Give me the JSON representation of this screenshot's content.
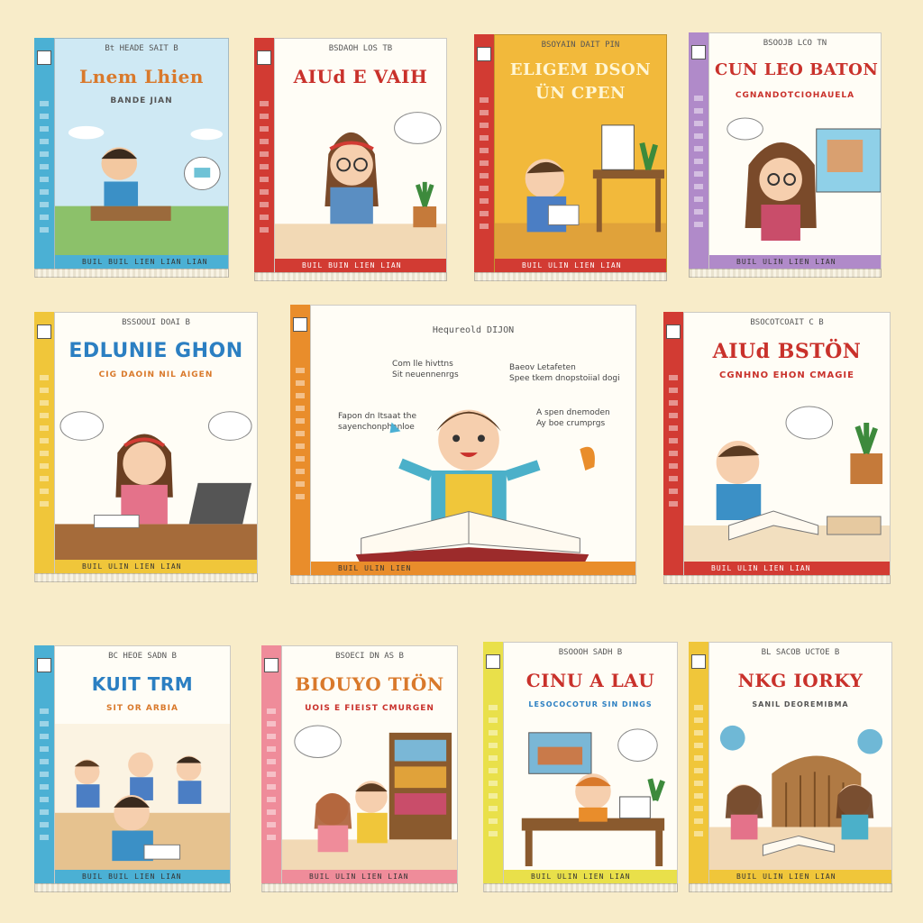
{
  "colors": {
    "background": "#f8ecc9",
    "blue": "#4bb0d4",
    "red": "#d23b33",
    "orange": "#e98d2b",
    "purple": "#b08ac9",
    "yellow": "#f0c63a",
    "pink": "#ef8c9a",
    "lightyellow": "#e9e04a"
  },
  "books": [
    {
      "series": "Bt HEADE SAIT B",
      "title": "Lnem Lhien",
      "subtitle": "BANDE JIAN",
      "band": "BUIL BUIL LIEN LIAN LIAN"
    },
    {
      "series": "BSDAOH LOS TB",
      "title": "AIUd E VAIH",
      "subtitle": "",
      "band": "BUIL BUIN LIEN LIAN"
    },
    {
      "series": "BSOYAIN DAIT PIN",
      "title": "ELIGEM DSON ÜN CPEN",
      "subtitle": "",
      "band": "BUIL ULIN LIEN LIAN"
    },
    {
      "series": "BSOOJB LCO TN",
      "title": "CUN LEO BATON",
      "subtitle": "CGNANDOTCIOHAUELA",
      "band": "BUIL ULIN LIEN LIAN"
    },
    {
      "series": "BSSOOUI DOAI B",
      "title": "EDLUNIE GHON",
      "subtitle": "CIG DAOIN NIL AIGEN",
      "band": "BUIL ULIN LIEN LIAN"
    },
    {
      "series": "Hequreold DIJON",
      "title": "",
      "subtitle": "",
      "band": "BUIL ULIN LIEN",
      "labels": [
        "Com lle hivttns",
        "Sit neuennenrgs",
        "Baeov Letafeten",
        "Spee tkem dnopstoiial dogi",
        "Fapon dn Itsaat the",
        "sayenchonphanloe",
        "A spen dnemoden",
        "Ay boe crumprgs"
      ]
    },
    {
      "series": "BSOCOTCOAIT C B",
      "title": "AIUd BSTÖN",
      "subtitle": "CGNHNÖ EHON CMAGIE",
      "band": "BUIL ULIN LIEN LIAN"
    },
    {
      "series": "BC HEOE SADN B",
      "title": "KUIT TRM",
      "subtitle": "SIT OR ARBIA",
      "band": "BUIL BUIL LIEN LIAN"
    },
    {
      "series": "BSOECI DN AS B",
      "title": "BIOUYO TIÖN",
      "subtitle": "UOIS E FIEIST CMURGEN",
      "band": "BUIL ULIN LIEN LIAN"
    },
    {
      "series": "BSOOOH SADH B",
      "title": "CINU A LAU",
      "subtitle": "LESOCOCOTUR SIN DINGS",
      "band": "BUIL ULIN LIEN LIAN"
    },
    {
      "series": "BL SACOB UCTOE B",
      "title": "NKG IORKY",
      "subtitle": "SANIL DEOREMIBMA",
      "band": "BUIL ULIN LIEN LIAN"
    }
  ]
}
